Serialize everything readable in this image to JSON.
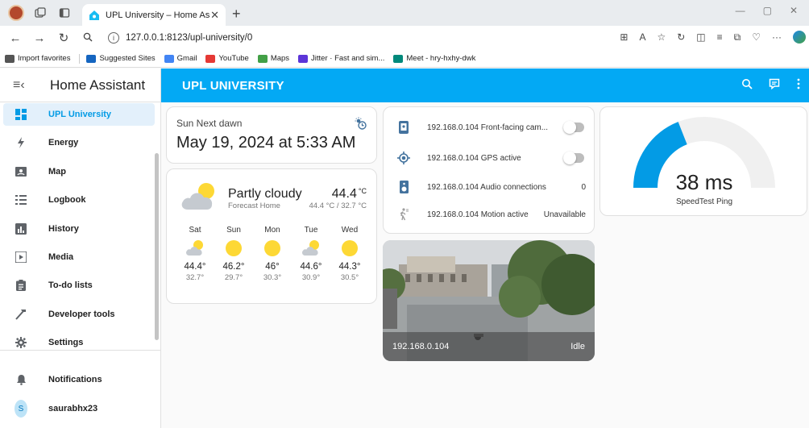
{
  "browser": {
    "tab_title": "UPL University – Home Assistant",
    "url": "127.0.0.1:8123/upl-university/0",
    "favorites": [
      {
        "label": "Import favorites",
        "color": "#555555"
      },
      {
        "label": "Suggested Sites",
        "color": "#1565c0"
      },
      {
        "label": "Gmail",
        "color": "#4285f4"
      },
      {
        "label": "YouTube",
        "color": "#e53935"
      },
      {
        "label": "Maps",
        "color": "#43a047"
      },
      {
        "label": "Jitter · Fast and sim...",
        "color": "#5c35d8"
      },
      {
        "label": "Meet - hry-hxhy-dwk",
        "color": "#00897b"
      }
    ]
  },
  "sidebar": {
    "title": "Home Assistant",
    "items": [
      {
        "label": "UPL University",
        "icon": "dashboard-icon"
      },
      {
        "label": "Energy",
        "icon": "lightning-icon"
      },
      {
        "label": "Map",
        "icon": "map-icon"
      },
      {
        "label": "Logbook",
        "icon": "list-icon"
      },
      {
        "label": "History",
        "icon": "chart-icon"
      },
      {
        "label": "Media",
        "icon": "play-icon"
      },
      {
        "label": "To-do lists",
        "icon": "clipboard-icon"
      },
      {
        "label": "Developer tools",
        "icon": "hammer-icon"
      },
      {
        "label": "Settings",
        "icon": "gear-icon"
      }
    ],
    "notifications": "Notifications",
    "user": {
      "initial": "S",
      "name": "saurabhx23"
    }
  },
  "header": {
    "title": "UPL UNIVERSITY"
  },
  "sun": {
    "label": "Sun Next dawn",
    "value": "May 19, 2024 at 5:33 AM"
  },
  "weather": {
    "state": "Partly cloudy",
    "name": "Forecast Home",
    "temp": "44.4",
    "unit": "°C",
    "highlow": "44.4 °C / 32.7 °C",
    "forecast": [
      {
        "day": "Sat",
        "icon": "partly-cloudy",
        "hi": "44.4°",
        "lo": "32.7°"
      },
      {
        "day": "Sun",
        "icon": "sunny",
        "hi": "46.2°",
        "lo": "29.7°"
      },
      {
        "day": "Mon",
        "icon": "sunny",
        "hi": "46°",
        "lo": "30.3°"
      },
      {
        "day": "Tue",
        "icon": "partly-cloudy",
        "hi": "44.6°",
        "lo": "30.9°"
      },
      {
        "day": "Wed",
        "icon": "sunny",
        "hi": "44.3°",
        "lo": "30.5°"
      }
    ]
  },
  "entities": [
    {
      "name": "192.168.0.104 Front-facing cam...",
      "type": "toggle",
      "state": "off",
      "icon": "cellphone-icon"
    },
    {
      "name": "192.168.0.104 GPS active",
      "type": "toggle",
      "state": "off",
      "icon": "crosshairs-gps-icon"
    },
    {
      "name": "192.168.0.104 Audio connections",
      "type": "value",
      "state": "0",
      "icon": "speaker-icon"
    },
    {
      "name": "192.168.0.104 Motion active",
      "type": "value",
      "state": "Unavailable",
      "icon": "walk-icon"
    }
  ],
  "camera": {
    "name": "192.168.0.104",
    "state": "Idle"
  },
  "gauge": {
    "value": "38 ms",
    "name": "SpeedTest Ping",
    "fraction": 0.38,
    "color": "#039be5"
  },
  "colors": {
    "primary": "#03a9f4",
    "active": "#039be5",
    "sun": "#fdd835"
  }
}
